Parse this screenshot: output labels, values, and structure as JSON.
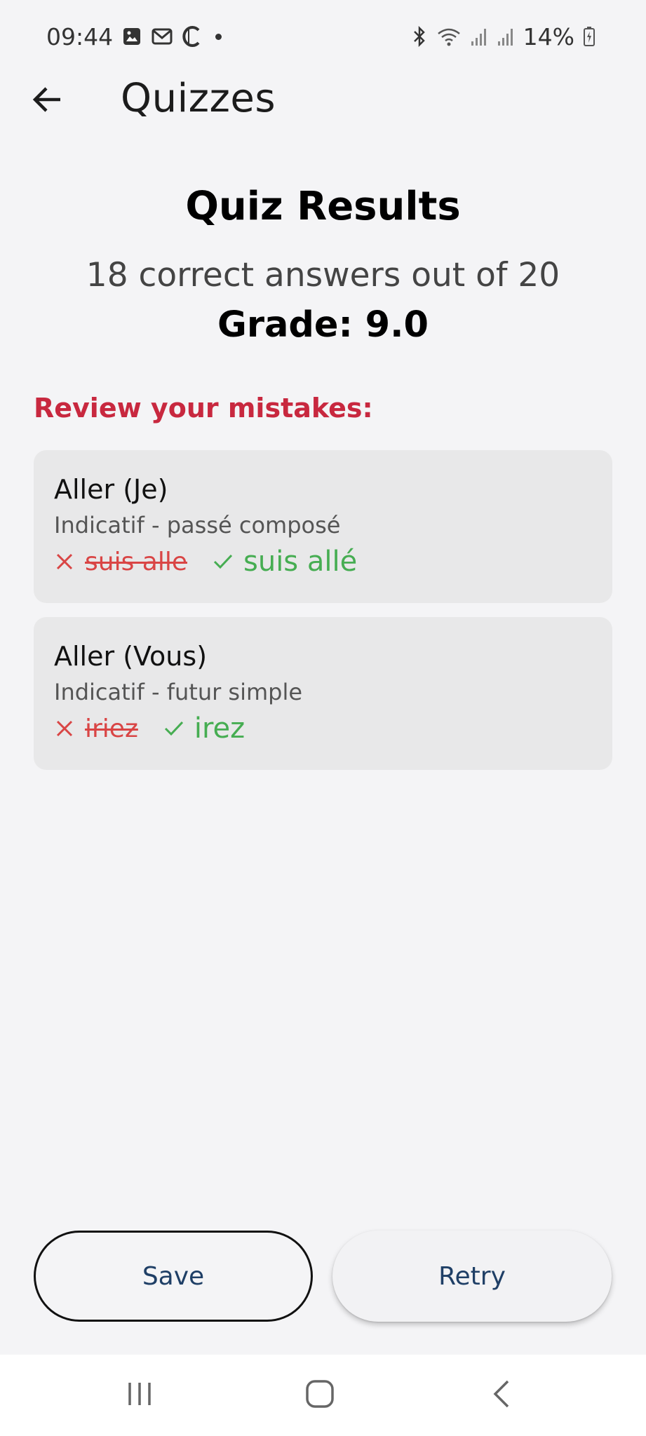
{
  "status_bar": {
    "time": "09:44",
    "battery": "14%",
    "left_icons": [
      "gallery-icon",
      "gmail-icon",
      "c-app-icon",
      "dot-icon"
    ],
    "right_icons": [
      "bluetooth-icon",
      "wifi-icon",
      "signal-icon",
      "signal-icon",
      "battery-charging-icon"
    ]
  },
  "app_bar": {
    "title": "Quizzes",
    "back_icon": "arrow-left-icon"
  },
  "results": {
    "title": "Quiz Results",
    "summary": "18 correct answers out of 20",
    "grade": "Grade: 9.0"
  },
  "review": {
    "heading": "Review your mistakes:",
    "mistakes": [
      {
        "verb": "Aller (Je)",
        "tense": "Indicatif - passé composé",
        "wrong": "suis alle",
        "correct": "suis allé"
      },
      {
        "verb": "Aller (Vous)",
        "tense": "Indicatif - futur simple",
        "wrong": "iriez",
        "correct": "irez"
      }
    ]
  },
  "actions": {
    "save_label": "Save",
    "retry_label": "Retry"
  },
  "colors": {
    "background": "#f4f4f6",
    "card": "#e8e8e9",
    "heading_red": "#c8283f",
    "wrong_red": "#d94545",
    "correct_green": "#46ad52",
    "button_text": "#1f3f66"
  },
  "nav_bar": {
    "icons": [
      "recent-apps-icon",
      "home-icon",
      "back-icon"
    ]
  }
}
